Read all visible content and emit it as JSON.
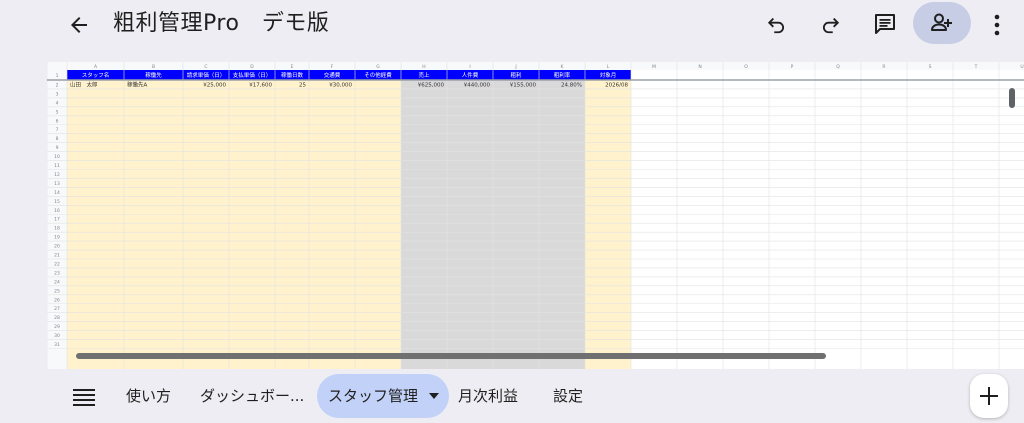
{
  "app": {
    "title": "粗利管理Pro　デモ版"
  },
  "icons": {
    "back": "arrow-left-icon",
    "undo": "undo-icon",
    "redo": "redo-icon",
    "comment": "comment-icon",
    "share": "person-add-icon",
    "more": "more-vertical-icon",
    "menu": "menu-list-icon",
    "add": "plus-icon"
  },
  "colors": {
    "header_fill": "#0000ff",
    "input_fill": "#fff2cc",
    "calc_fill": "#d9d9d9",
    "share_button": "#c8cde6",
    "active_tab": "#c2d1f7"
  },
  "sheet": {
    "column_letters": [
      "A",
      "B",
      "C",
      "D",
      "E",
      "F",
      "G",
      "H",
      "I",
      "J",
      "K",
      "L",
      "M",
      "N",
      "O",
      "P",
      "Q",
      "R",
      "S",
      "T",
      "U"
    ],
    "headers": [
      "スタッフ名",
      "稼働先",
      "請求単価（日）",
      "支払単価（日）",
      "稼働日数",
      "交通費",
      "その他経費",
      "売上",
      "人件費",
      "粗利",
      "粗利率",
      "対象月"
    ],
    "rows": [
      [
        "山田　太郎",
        "稼働先A",
        "¥25,000",
        "¥17,600",
        "25",
        "¥30,000",
        "",
        "¥625,000",
        "¥440,000",
        "¥155,000",
        "24.80%",
        "2026/08"
      ]
    ],
    "row_count": 31
  },
  "tabs": {
    "items": [
      "使い方",
      "ダッシュボー...",
      "スタッフ管理",
      "月次利益",
      "設定"
    ],
    "active_index": 2
  }
}
